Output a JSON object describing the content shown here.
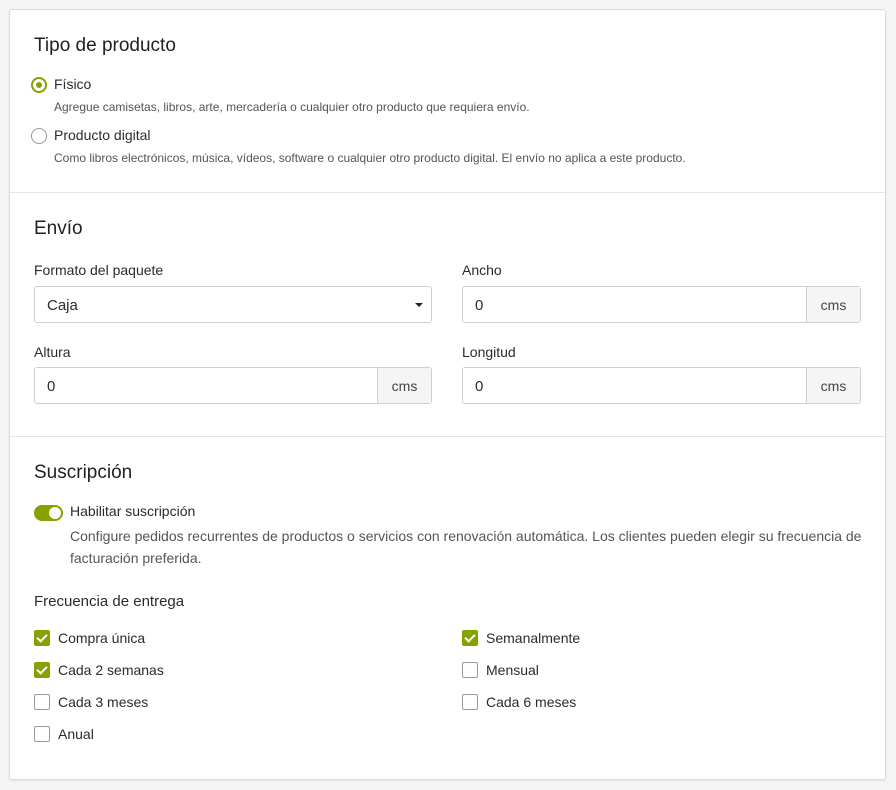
{
  "product_type": {
    "title": "Tipo de producto",
    "options": [
      {
        "label": "Físico",
        "description": "Agregue camisetas, libros, arte, mercadería o cualquier otro producto que requiera envío.",
        "selected": true
      },
      {
        "label": "Producto digital",
        "description": "Como libros electrónicos, música, vídeos, software o cualquier otro producto digital. El envío no aplica a este producto.",
        "selected": false
      }
    ]
  },
  "shipping": {
    "title": "Envío",
    "package_format": {
      "label": "Formato del paquete",
      "value": "Caja"
    },
    "width": {
      "label": "Ancho",
      "value": "0",
      "unit": "cms"
    },
    "height": {
      "label": "Altura",
      "value": "0",
      "unit": "cms"
    },
    "length": {
      "label": "Longitud",
      "value": "0",
      "unit": "cms"
    }
  },
  "subscription": {
    "title": "Suscripción",
    "toggle_label": "Habilitar suscripción",
    "toggle_on": true,
    "description": "Configure pedidos recurrentes de productos o servicios con renovación automática. Los clientes pueden elegir su frecuencia de facturación preferida.",
    "frequency_title": "Frecuencia de entrega",
    "frequencies": [
      {
        "label": "Compra única",
        "checked": true
      },
      {
        "label": "Semanalmente",
        "checked": true
      },
      {
        "label": "Cada 2 semanas",
        "checked": true
      },
      {
        "label": "Mensual",
        "checked": false
      },
      {
        "label": "Cada 3 meses",
        "checked": false
      },
      {
        "label": "Cada 6 meses",
        "checked": false
      },
      {
        "label": "Anual",
        "checked": false
      }
    ]
  },
  "colors": {
    "accent": "#85a300",
    "border": "#cfcfcf"
  }
}
